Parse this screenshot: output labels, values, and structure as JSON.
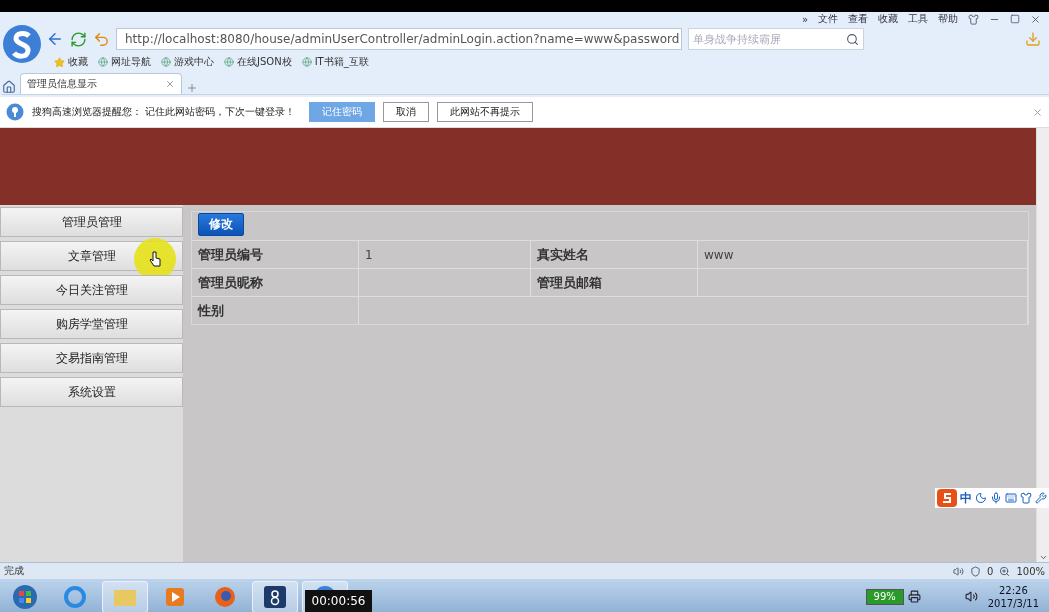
{
  "browser": {
    "menu": [
      "»",
      "文件",
      "查看",
      "收藏",
      "工具",
      "帮助"
    ],
    "address": "http://localhost:8080/house/adminUserController/adminLogin.action?name=www&password",
    "search_placeholder": "单身战争持续霸屏",
    "bookmarks": [
      "收藏",
      "网址导航",
      "游戏中心",
      "在线JSON校",
      "IT书籍_互联"
    ],
    "tabs": [
      {
        "title": "管理员信息显示",
        "selected": true
      }
    ]
  },
  "notification": {
    "message": "搜狗高速浏览器提醒您： 记住此网站密码，下次一键登录！",
    "buttons": [
      {
        "label": "记住密码",
        "primary": true
      },
      {
        "label": "取消",
        "primary": false
      },
      {
        "label": "此网站不再提示",
        "primary": false
      }
    ]
  },
  "sidebar": {
    "items": [
      {
        "label": "管理员管理",
        "hovered": false
      },
      {
        "label": "文章管理",
        "hovered": true
      },
      {
        "label": "今日关注管理",
        "hovered": false
      },
      {
        "label": "购房学堂管理",
        "hovered": false
      },
      {
        "label": "交易指南管理",
        "hovered": false
      },
      {
        "label": "系统设置",
        "hovered": false
      }
    ]
  },
  "edit_button": "修改",
  "details": {
    "rows": [
      [
        {
          "label": "管理员编号",
          "value": "1"
        },
        {
          "label": "真实姓名",
          "value": "www"
        }
      ],
      [
        {
          "label": "管理员昵称"
        },
        {
          "label": "管理员邮箱"
        }
      ],
      [
        {
          "label": "性别"
        }
      ]
    ]
  },
  "ime": {
    "label": "中"
  },
  "status_bar": {
    "text": "完成",
    "count": "0",
    "zoom": "100%"
  },
  "taskbar": {
    "battery": "99%",
    "time": "22:26",
    "date": "2017/3/11"
  },
  "video_overlay": {
    "timestamp": "00:00:56"
  }
}
